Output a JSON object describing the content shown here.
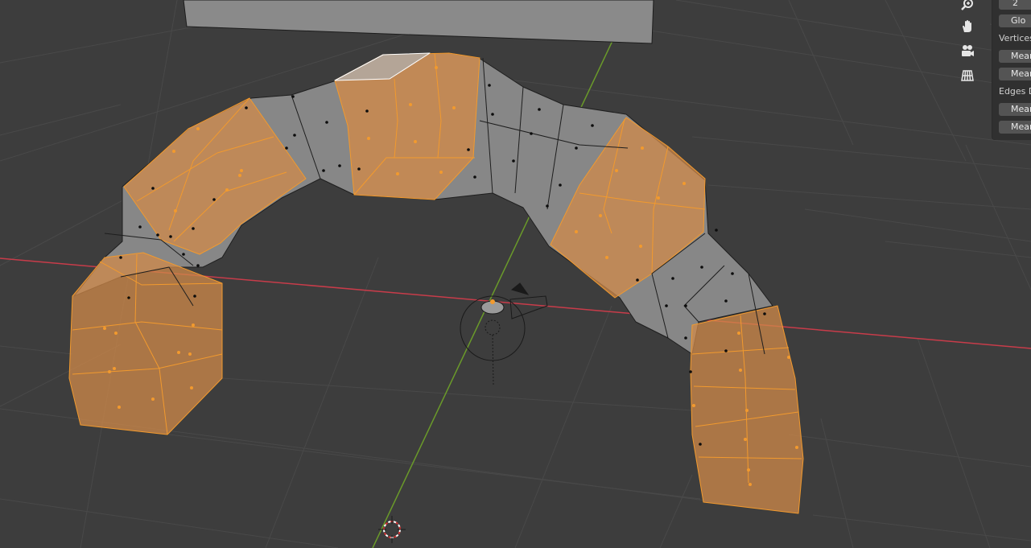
{
  "viewport": {
    "background": "#3d3d3d",
    "grid_color": "#4a4a4a",
    "x_axis_color": "#c83c4a",
    "y_axis_color": "#6a9a2a",
    "selection_color": "#f29a2e",
    "active_color": "#ffffff"
  },
  "nav_gizmo": {
    "icons": [
      "zoom-icon",
      "hand-pan-icon",
      "camera-view-icon",
      "ortho-grid-icon"
    ]
  },
  "sidebar": {
    "top_field_value": "2",
    "global_button_label": "Glo",
    "vertices_label": "Vertices",
    "vertices_buttons": [
      "Mean",
      "Mean"
    ],
    "edges_label": "Edges D",
    "edges_buttons": [
      "Mean",
      "Mean"
    ]
  }
}
